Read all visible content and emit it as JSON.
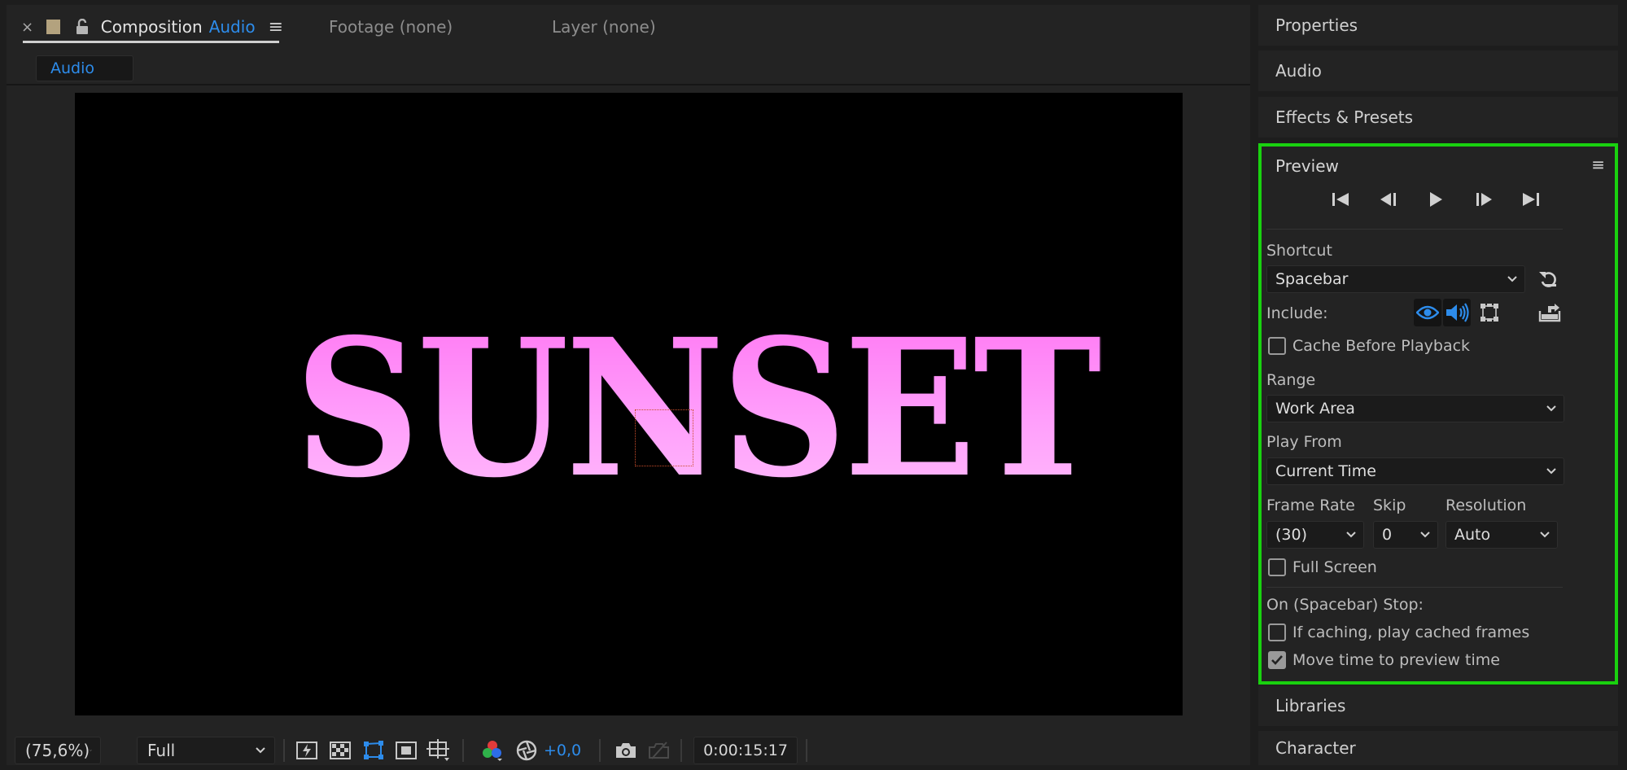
{
  "composition_panel": {
    "tab": {
      "close_glyph": "×",
      "prefix": "Composition",
      "name": "Audio",
      "menu_glyph": "≡"
    },
    "footage_tab": "Footage (none)",
    "layer_tab": "Layer (none)",
    "breadcrumb": "Audio",
    "viewer_text": "SUNSET",
    "toolbar": {
      "zoom": "(75,6%)",
      "resolution": "Full",
      "exposure": "+0,0",
      "timecode": "0:00:15:17"
    }
  },
  "side_panels": {
    "properties": "Properties",
    "audio": "Audio",
    "effects": "Effects & Presets",
    "libraries": "Libraries",
    "character": "Character"
  },
  "preview": {
    "title": "Preview",
    "menu_glyph": "≡",
    "shortcut_label": "Shortcut",
    "shortcut_value": "Spacebar",
    "include_label": "Include:",
    "cache_before_playback": {
      "label": "Cache Before Playback",
      "checked": false
    },
    "range_label": "Range",
    "range_value": "Work Area",
    "play_from_label": "Play From",
    "play_from_value": "Current Time",
    "frame_rate_label": "Frame Rate",
    "frame_rate_value": "(30)",
    "skip_label": "Skip",
    "skip_value": "0",
    "resolution_label": "Resolution",
    "resolution_value": "Auto",
    "full_screen": {
      "label": "Full Screen",
      "checked": false
    },
    "stop_label": "On (Spacebar) Stop:",
    "if_caching": {
      "label": "If caching, play cached frames",
      "checked": false
    },
    "move_time": {
      "label": "Move time to preview time",
      "checked": true
    }
  },
  "colors": {
    "accent_blue": "#2d8ceb",
    "highlight_green": "#19d10f",
    "text_pink": "#ffb0ff",
    "comp_swatch": "#b3a27e"
  }
}
